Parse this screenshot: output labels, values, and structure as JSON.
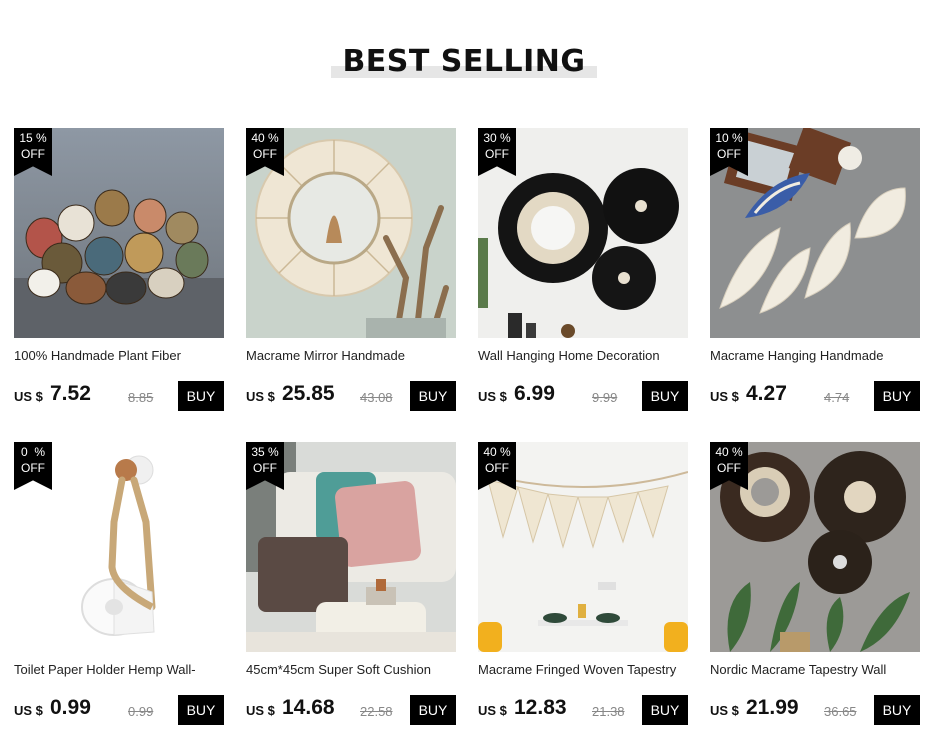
{
  "heading": "BEST SELLING",
  "currency_label": "US $",
  "buy_label": "BUY",
  "off_label": "OFF",
  "products": [
    {
      "title": "100% Handmade Plant Fiber",
      "price": "7.52",
      "old_price": "8.85",
      "discount": "15 %"
    },
    {
      "title": "Macrame Mirror Handmade",
      "price": "25.85",
      "old_price": "43.08",
      "discount": "40 %"
    },
    {
      "title": "Wall Hanging Home Decoration",
      "price": "6.99",
      "old_price": "9.99",
      "discount": "30 %"
    },
    {
      "title": "Macrame Hanging Handmade",
      "price": "4.27",
      "old_price": "4.74",
      "discount": "10 %"
    },
    {
      "title": "Toilet Paper Holder Hemp Wall-",
      "price": "0.99",
      "old_price": "0.99",
      "discount": "0  %"
    },
    {
      "title": "45cm*45cm Super Soft Cushion",
      "price": "14.68",
      "old_price": "22.58",
      "discount": "35 %"
    },
    {
      "title": "Macrame Fringed Woven Tapestry",
      "price": "12.83",
      "old_price": "21.38",
      "discount": "40 %"
    },
    {
      "title": "Nordic Macrame Tapestry Wall",
      "price": "21.99",
      "old_price": "36.65",
      "discount": "40 %"
    }
  ]
}
